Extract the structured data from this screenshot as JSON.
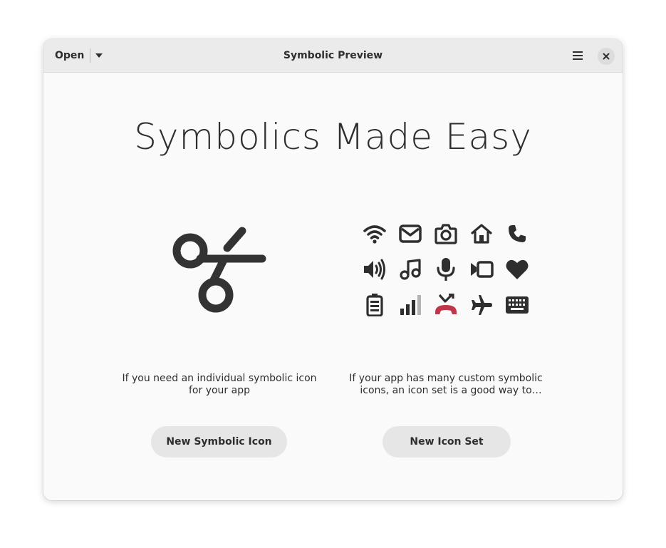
{
  "window": {
    "title": "Symbolic Preview",
    "open_label": "Open"
  },
  "icons": {
    "dropdown": "pan-down-icon",
    "menu": "hamburger-menu-icon",
    "close": "close-icon",
    "hero": "scissors-icon",
    "grid": [
      "wifi-icon",
      "mail-icon",
      "camera-icon",
      "home-icon",
      "phone-icon",
      "volume-icon",
      "music-note-icon",
      "microphone-icon",
      "video-camera-icon",
      "heart-icon",
      "battery-icon",
      "signal-bars-icon",
      "call-hangup-icon",
      "airplane-icon",
      "keyboard-icon"
    ]
  },
  "main": {
    "headline": "Symbolics Made Easy",
    "single": {
      "description": "If you need an individual symbolic icon for your app",
      "button_label": "New Symbolic Icon"
    },
    "set": {
      "description": "If your app has many custom symbolic icons, an icon set is a good way to manag…",
      "button_label": "New Icon Set"
    }
  },
  "colors": {
    "icon": "#2e2e2e",
    "hangup": "#c0364a",
    "window_bg": "#fafafa",
    "headerbar_bg": "#ebebeb",
    "button_bg": "#e6e6e6"
  }
}
